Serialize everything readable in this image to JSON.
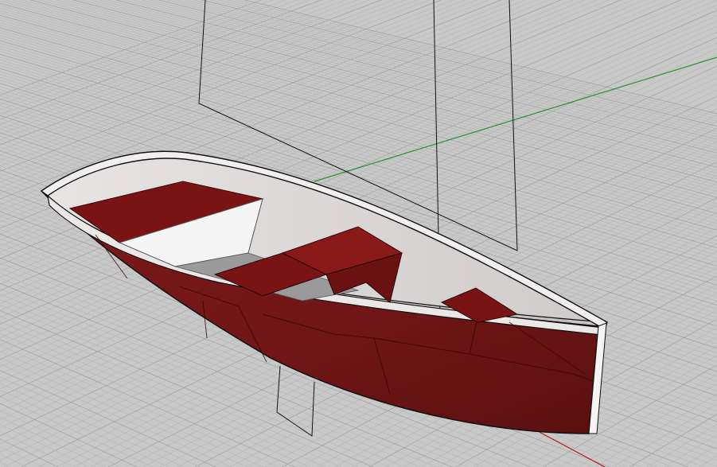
{
  "viewport": {
    "background": "#c8c8c8",
    "grid_minor_color": "#b6b6b6",
    "grid_major_color": "#9c9c9c",
    "x_axis_color": "#b11a1a",
    "y_axis_color": "#2e8f2e"
  },
  "model": {
    "hull_exterior_color": "#8a1f1f",
    "hull_interior_color": "#dcd8d8",
    "gunwale_color": "#f0eeee",
    "edge_color": "#111111",
    "seat_color": "#7a1414",
    "sail_line_color": "#111111"
  }
}
